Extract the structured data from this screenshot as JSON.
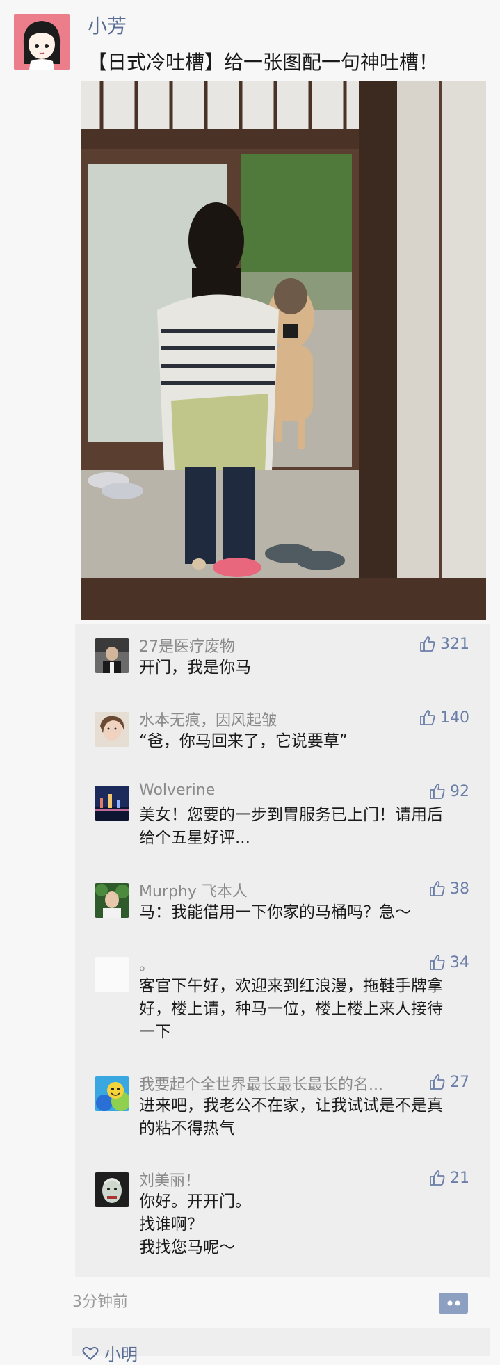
{
  "post": {
    "author": "小芳",
    "text": "【日式冷吐槽】给一张图配一句神吐槽！",
    "image_icon": "photo-girl-opening-door-to-horse",
    "timestamp": "3分钟前"
  },
  "comments": [
    {
      "name": "27是医疗废物",
      "likes": "321",
      "text": "开门，我是你马"
    },
    {
      "name": "水本无痕，因风起皱",
      "likes": "140",
      "text": "“爸，你马回来了，它说要草”"
    },
    {
      "name": "Wolverine",
      "likes": "92",
      "text": "美女！您要的一步到胃服务已上门！请用后\n给个五星好评..."
    },
    {
      "name": "Murphy 飞本人",
      "likes": "38",
      "text": "马：我能借用一下你家的马桶吗？急～"
    },
    {
      "name": "。",
      "likes": "34",
      "text": "客官下午好，欢迎来到红浪漫，拖鞋手牌拿\n好，楼上请，种马一位，楼上楼上来人接待\n一下"
    },
    {
      "name": "我要起个全世界最长最长最长的名...",
      "likes": "27",
      "text": "进来吧，我老公不在家，让我试试是不是真\n的粘不得热气"
    },
    {
      "name": "刘美丽！",
      "likes": "21",
      "text": "你好。开开门。\n找谁啊？\n我找您马呢～"
    }
  ],
  "next_post": {
    "author_partial": "小明"
  },
  "colors": {
    "link": "#576b95",
    "comment_bg": "#eeeeee",
    "page_bg": "#f7f7f7"
  }
}
